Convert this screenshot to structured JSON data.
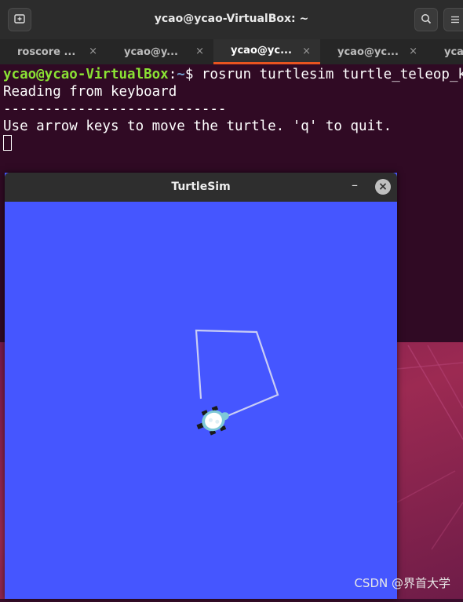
{
  "terminal": {
    "title": "ycao@ycao-VirtualBox: ~",
    "tabs": [
      {
        "label": "roscore ...",
        "close": "×"
      },
      {
        "label": "ycao@y...",
        "close": "×"
      },
      {
        "label": "ycao@yc...",
        "close": "×"
      },
      {
        "label": "ycao@yc...",
        "close": "×"
      },
      {
        "label": "yca",
        "close": ""
      }
    ],
    "prompt_user": "ycao@ycao-VirtualBox",
    "prompt_sep": ":",
    "prompt_path": "~",
    "prompt_symbol": "$ ",
    "command": "rosrun turtlesim turtle_teleop_key",
    "lines": [
      "Reading from keyboard",
      "---------------------------",
      "Use arrow keys to move the turtle. 'q' to quit."
    ]
  },
  "turtlesim": {
    "title": "TurtleSim",
    "minimize": "–",
    "close": "×",
    "background_color": "#4556ff",
    "trail_color": "#c9cdf5"
  },
  "icons": {
    "new_tab": "new-tab-icon",
    "search": "search-icon",
    "menu": "hamburger-menu-icon"
  },
  "watermark": "CSDN @界首大学"
}
